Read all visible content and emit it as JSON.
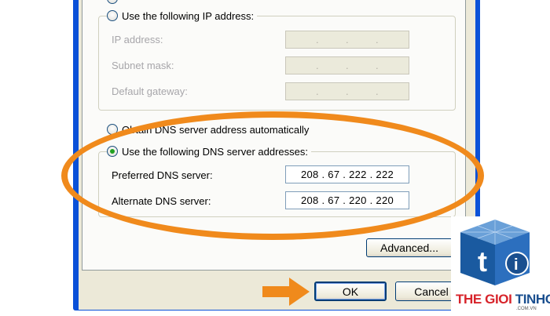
{
  "ip_section": {
    "radio_obtain_label": "",
    "radio_use_label": "Use the following IP address:",
    "ip_address_label": "IP address:",
    "subnet_mask_label": "Subnet mask:",
    "default_gateway_label": "Default gateway:",
    "empty_field_dots": [
      ".",
      ".",
      "."
    ]
  },
  "dns_section": {
    "radio_obtain_label": "Obtain DNS server address automatically",
    "radio_use_label": "Use the following DNS server addresses:",
    "preferred_label": "Preferred DNS server:",
    "preferred_value": "208 . 67 . 222 . 222",
    "alternate_label": "Alternate DNS server:",
    "alternate_value": "208 . 67 . 220 . 220"
  },
  "buttons": {
    "advanced": "Advanced...",
    "ok": "OK",
    "cancel": "Cancel"
  },
  "watermark": {
    "brand_part1": "THE GIOI",
    "brand_part2": "TINHOC",
    "domain": ".COM.VN",
    "logo_letter": "t",
    "logo_info": "i"
  },
  "colors": {
    "highlight_orange": "#f08a1c",
    "window_border_blue": "#0a51d8",
    "dialog_background": "#ece9d8"
  },
  "icons": [
    "radio-button",
    "arrow-right",
    "cube-logo"
  ]
}
